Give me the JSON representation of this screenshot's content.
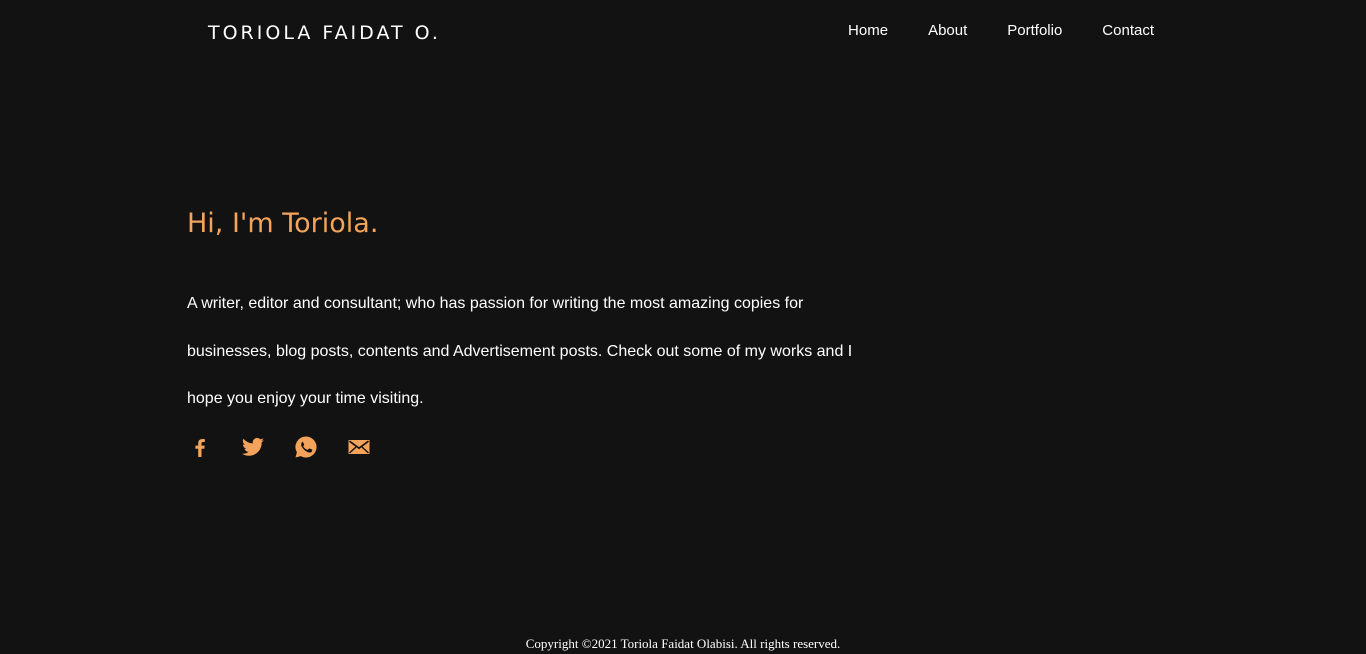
{
  "header": {
    "brand": "TORIOLA FAIDAT O.",
    "nav": [
      {
        "label": "Home"
      },
      {
        "label": "About"
      },
      {
        "label": "Portfolio"
      },
      {
        "label": "Contact"
      }
    ]
  },
  "hero": {
    "title": "Hi, I'm Toriola.",
    "description": "A writer, editor and consultant; who has passion for writing the most amazing copies for businesses, blog posts, contents and Advertisement posts. Check out some of my works and I hope you enjoy your time visiting."
  },
  "socials": [
    {
      "icon": "facebook-icon"
    },
    {
      "icon": "twitter-icon"
    },
    {
      "icon": "whatsapp-icon"
    },
    {
      "icon": "mail-icon"
    }
  ],
  "footer": {
    "copyright": "Copyright ©2021 Toriola Faidat Olabisi. All rights reserved."
  },
  "colors": {
    "background": "#121212",
    "accent": "#f3a35a",
    "text": "#ffffff"
  }
}
